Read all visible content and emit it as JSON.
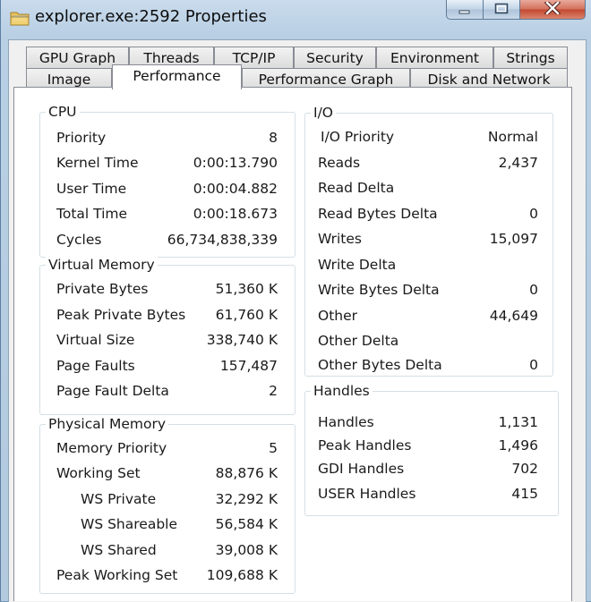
{
  "window": {
    "title": "explorer.exe:2592 Properties",
    "icon": "folder-icon",
    "buttons": {
      "minimize": "minimize-icon",
      "maximize": "maximize-icon",
      "close": "close-icon"
    }
  },
  "tabs_top": [
    "GPU Graph",
    "Threads",
    "TCP/IP",
    "Security",
    "Environment",
    "Strings"
  ],
  "tabs_bottom": [
    "Image",
    "Performance",
    "Performance Graph",
    "Disk and Network"
  ],
  "active_tab": "Performance",
  "cpu": {
    "title": "CPU",
    "rows": [
      {
        "label": "Priority",
        "value": "8"
      },
      {
        "label": "Kernel Time",
        "value": "0:00:13.790"
      },
      {
        "label": "User Time",
        "value": "0:00:04.882"
      },
      {
        "label": "Total Time",
        "value": "0:00:18.673"
      },
      {
        "label": "Cycles",
        "value": "66,734,838,339"
      }
    ]
  },
  "virtual_memory": {
    "title": "Virtual Memory",
    "rows": [
      {
        "label": "Private Bytes",
        "value": "51,360 K"
      },
      {
        "label": "Peak Private Bytes",
        "value": "61,760 K"
      },
      {
        "label": "Virtual Size",
        "value": "338,740 K"
      },
      {
        "label": "Page Faults",
        "value": "157,487"
      },
      {
        "label": "Page Fault Delta",
        "value": "2"
      }
    ]
  },
  "physical_memory": {
    "title": "Physical Memory",
    "rows": [
      {
        "label": "Memory Priority",
        "value": "5"
      },
      {
        "label": "Working Set",
        "value": "88,876 K"
      },
      {
        "label": "WS Private",
        "value": "32,292 K"
      },
      {
        "label": "WS Shareable",
        "value": "56,584 K"
      },
      {
        "label": "WS Shared",
        "value": "39,008 K"
      },
      {
        "label": "Peak Working Set",
        "value": "109,688 K"
      }
    ]
  },
  "io": {
    "title": "I/O",
    "rows": [
      {
        "label": "I/O Priority",
        "value": "Normal"
      },
      {
        "label": "Reads",
        "value": "2,437"
      },
      {
        "label": "Read Delta",
        "value": ""
      },
      {
        "label": "Read Bytes Delta",
        "value": "0"
      },
      {
        "label": "Writes",
        "value": "15,097"
      },
      {
        "label": "Write Delta",
        "value": ""
      },
      {
        "label": "Write Bytes Delta",
        "value": "0"
      },
      {
        "label": "Other",
        "value": "44,649"
      },
      {
        "label": "Other Delta",
        "value": ""
      },
      {
        "label": "Other Bytes Delta",
        "value": "0"
      }
    ]
  },
  "handles": {
    "title": "Handles",
    "rows": [
      {
        "label": "Handles",
        "value": "1,131"
      },
      {
        "label": "Peak Handles",
        "value": "1,496"
      },
      {
        "label": "GDI Handles",
        "value": "702"
      },
      {
        "label": "USER Handles",
        "value": "415"
      }
    ]
  }
}
